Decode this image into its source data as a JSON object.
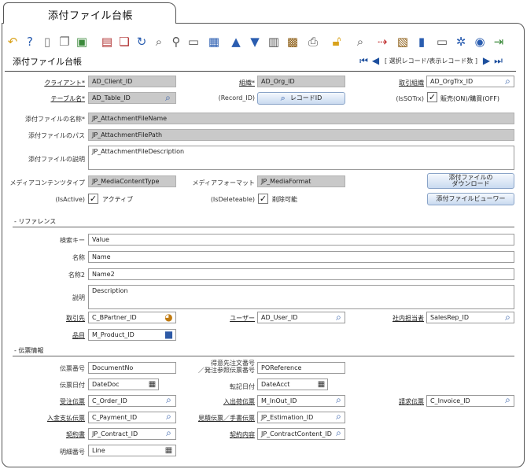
{
  "tab": {
    "title": "添付ファイル台帳"
  },
  "window": {
    "title": "添付ファイル台帳"
  },
  "navigation": {
    "record_text": "[ 選択レコード/表示レコード数 ]"
  },
  "toolbar": {
    "icons": [
      "undo-icon",
      "help-icon",
      "new-record-icon",
      "copy-record-icon",
      "delete-icon",
      "save-icon",
      "multi-save-icon",
      "refresh-icon",
      "find-icon",
      "attachment-icon",
      "chat-icon",
      "grid-toggle-icon",
      "previous-record-icon",
      "next-record-icon",
      "report-icon",
      "archive-icon",
      "print-icon",
      "lock-icon",
      "zoom-across-icon",
      "workflow-icon",
      "product-info-icon",
      "request-icon",
      "info-icon",
      "settings-icon",
      "user-icon",
      "exit-icon"
    ]
  },
  "fields": {
    "client": {
      "label": "クライアント*",
      "value": "AD_Client_ID"
    },
    "org": {
      "label": "組織*",
      "value": "AD_Org_ID"
    },
    "org_trx": {
      "label": "取引組織",
      "value": "AD_OrgTrx_ID"
    },
    "table": {
      "label": "テーブル名*",
      "value": "AD_Table_ID"
    },
    "record_id": {
      "label": "(Record_ID)",
      "button": "レコードID"
    },
    "is_sotrx": {
      "label": "(IsSOTrx)",
      "checkbox": "販売(ON)/購買(OFF)",
      "checked": true
    },
    "file_name": {
      "label": "添付ファイルの名称*",
      "value": "JP_AttachmentFileName"
    },
    "file_path": {
      "label": "添付ファイルのパス",
      "value": "JP_AttachmentFilePath"
    },
    "file_desc": {
      "label": "添付ファイルの説明",
      "value": "JP_AttachmentFileDescription"
    },
    "media_content_type": {
      "label": "メディアコンテンツタイプ",
      "value": "JP_MediaContentType"
    },
    "media_format": {
      "label": "メディアフォーマット",
      "value": "JP_MediaFormat"
    },
    "download_button": {
      "line1": "添付ファイルの",
      "line2": "ダウンロード"
    },
    "is_active": {
      "label": "(IsActive)",
      "checkbox": "アクティブ",
      "checked": true
    },
    "is_deleteable": {
      "label": "(IsDeleteable)",
      "checkbox": "削除可能",
      "checked": true
    },
    "viewer_button": {
      "label": "添付ファイルビューワー"
    }
  },
  "reference": {
    "section": "- リファレンス",
    "search_key": {
      "label": "検索キー",
      "value": "Value"
    },
    "name": {
      "label": "名称",
      "value": "Name"
    },
    "name2": {
      "label": "名称2",
      "value": "Name2"
    },
    "description": {
      "label": "説明",
      "value": "Description"
    },
    "bpartner": {
      "label": "取引先",
      "value": "C_BPartner_ID"
    },
    "user": {
      "label": "ユーザー",
      "value": "AD_User_ID"
    },
    "sales_rep": {
      "label": "社内担当者",
      "value": "SalesRep_ID"
    },
    "product": {
      "label": "品目",
      "value": "M_Product_ID"
    }
  },
  "document": {
    "section": "- 伝票情報",
    "document_no": {
      "label": "伝票番号",
      "value": "DocumentNo"
    },
    "po_reference": {
      "label_line1": "得意先注文番号",
      "label_line2": "／発注参照伝票番号",
      "value": "POReference"
    },
    "date_doc": {
      "label": "伝票日付",
      "value": "DateDoc"
    },
    "date_acct": {
      "label": "転記日付",
      "value": "DateAcct"
    },
    "order": {
      "label": "受注伝票",
      "value": "C_Order_ID"
    },
    "inout": {
      "label": "入出荷伝票",
      "value": "M_InOut_ID"
    },
    "invoice": {
      "label": "請求伝票",
      "value": "C_Invoice_ID"
    },
    "payment": {
      "label": "入金支払伝票",
      "value": "C_Payment_ID"
    },
    "estimation": {
      "label": "見積伝票／手書伝票",
      "value": "JP_Estimation_ID"
    },
    "contract": {
      "label": "契約書",
      "value": "JP_Contract_ID"
    },
    "contract_content": {
      "label": "契約内容",
      "value": "JP_ContractContent_ID"
    },
    "line": {
      "label": "明細番号",
      "value": "Line"
    }
  },
  "colors": {
    "readonly": "#c9c9c9",
    "accent": "#2a5db0",
    "button": "#c9daf0"
  }
}
